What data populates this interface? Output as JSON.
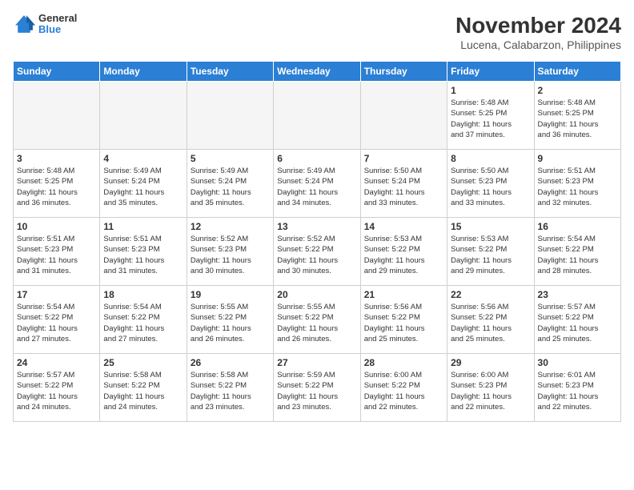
{
  "header": {
    "logo_line1": "General",
    "logo_line2": "Blue",
    "title": "November 2024",
    "subtitle": "Lucena, Calabarzon, Philippines"
  },
  "weekdays": [
    "Sunday",
    "Monday",
    "Tuesday",
    "Wednesday",
    "Thursday",
    "Friday",
    "Saturday"
  ],
  "weeks": [
    [
      {
        "day": "",
        "info": ""
      },
      {
        "day": "",
        "info": ""
      },
      {
        "day": "",
        "info": ""
      },
      {
        "day": "",
        "info": ""
      },
      {
        "day": "",
        "info": ""
      },
      {
        "day": "1",
        "info": "Sunrise: 5:48 AM\nSunset: 5:25 PM\nDaylight: 11 hours\nand 37 minutes."
      },
      {
        "day": "2",
        "info": "Sunrise: 5:48 AM\nSunset: 5:25 PM\nDaylight: 11 hours\nand 36 minutes."
      }
    ],
    [
      {
        "day": "3",
        "info": "Sunrise: 5:48 AM\nSunset: 5:25 PM\nDaylight: 11 hours\nand 36 minutes."
      },
      {
        "day": "4",
        "info": "Sunrise: 5:49 AM\nSunset: 5:24 PM\nDaylight: 11 hours\nand 35 minutes."
      },
      {
        "day": "5",
        "info": "Sunrise: 5:49 AM\nSunset: 5:24 PM\nDaylight: 11 hours\nand 35 minutes."
      },
      {
        "day": "6",
        "info": "Sunrise: 5:49 AM\nSunset: 5:24 PM\nDaylight: 11 hours\nand 34 minutes."
      },
      {
        "day": "7",
        "info": "Sunrise: 5:50 AM\nSunset: 5:24 PM\nDaylight: 11 hours\nand 33 minutes."
      },
      {
        "day": "8",
        "info": "Sunrise: 5:50 AM\nSunset: 5:23 PM\nDaylight: 11 hours\nand 33 minutes."
      },
      {
        "day": "9",
        "info": "Sunrise: 5:51 AM\nSunset: 5:23 PM\nDaylight: 11 hours\nand 32 minutes."
      }
    ],
    [
      {
        "day": "10",
        "info": "Sunrise: 5:51 AM\nSunset: 5:23 PM\nDaylight: 11 hours\nand 31 minutes."
      },
      {
        "day": "11",
        "info": "Sunrise: 5:51 AM\nSunset: 5:23 PM\nDaylight: 11 hours\nand 31 minutes."
      },
      {
        "day": "12",
        "info": "Sunrise: 5:52 AM\nSunset: 5:23 PM\nDaylight: 11 hours\nand 30 minutes."
      },
      {
        "day": "13",
        "info": "Sunrise: 5:52 AM\nSunset: 5:22 PM\nDaylight: 11 hours\nand 30 minutes."
      },
      {
        "day": "14",
        "info": "Sunrise: 5:53 AM\nSunset: 5:22 PM\nDaylight: 11 hours\nand 29 minutes."
      },
      {
        "day": "15",
        "info": "Sunrise: 5:53 AM\nSunset: 5:22 PM\nDaylight: 11 hours\nand 29 minutes."
      },
      {
        "day": "16",
        "info": "Sunrise: 5:54 AM\nSunset: 5:22 PM\nDaylight: 11 hours\nand 28 minutes."
      }
    ],
    [
      {
        "day": "17",
        "info": "Sunrise: 5:54 AM\nSunset: 5:22 PM\nDaylight: 11 hours\nand 27 minutes."
      },
      {
        "day": "18",
        "info": "Sunrise: 5:54 AM\nSunset: 5:22 PM\nDaylight: 11 hours\nand 27 minutes."
      },
      {
        "day": "19",
        "info": "Sunrise: 5:55 AM\nSunset: 5:22 PM\nDaylight: 11 hours\nand 26 minutes."
      },
      {
        "day": "20",
        "info": "Sunrise: 5:55 AM\nSunset: 5:22 PM\nDaylight: 11 hours\nand 26 minutes."
      },
      {
        "day": "21",
        "info": "Sunrise: 5:56 AM\nSunset: 5:22 PM\nDaylight: 11 hours\nand 25 minutes."
      },
      {
        "day": "22",
        "info": "Sunrise: 5:56 AM\nSunset: 5:22 PM\nDaylight: 11 hours\nand 25 minutes."
      },
      {
        "day": "23",
        "info": "Sunrise: 5:57 AM\nSunset: 5:22 PM\nDaylight: 11 hours\nand 25 minutes."
      }
    ],
    [
      {
        "day": "24",
        "info": "Sunrise: 5:57 AM\nSunset: 5:22 PM\nDaylight: 11 hours\nand 24 minutes."
      },
      {
        "day": "25",
        "info": "Sunrise: 5:58 AM\nSunset: 5:22 PM\nDaylight: 11 hours\nand 24 minutes."
      },
      {
        "day": "26",
        "info": "Sunrise: 5:58 AM\nSunset: 5:22 PM\nDaylight: 11 hours\nand 23 minutes."
      },
      {
        "day": "27",
        "info": "Sunrise: 5:59 AM\nSunset: 5:22 PM\nDaylight: 11 hours\nand 23 minutes."
      },
      {
        "day": "28",
        "info": "Sunrise: 6:00 AM\nSunset: 5:22 PM\nDaylight: 11 hours\nand 22 minutes."
      },
      {
        "day": "29",
        "info": "Sunrise: 6:00 AM\nSunset: 5:23 PM\nDaylight: 11 hours\nand 22 minutes."
      },
      {
        "day": "30",
        "info": "Sunrise: 6:01 AM\nSunset: 5:23 PM\nDaylight: 11 hours\nand 22 minutes."
      }
    ]
  ]
}
